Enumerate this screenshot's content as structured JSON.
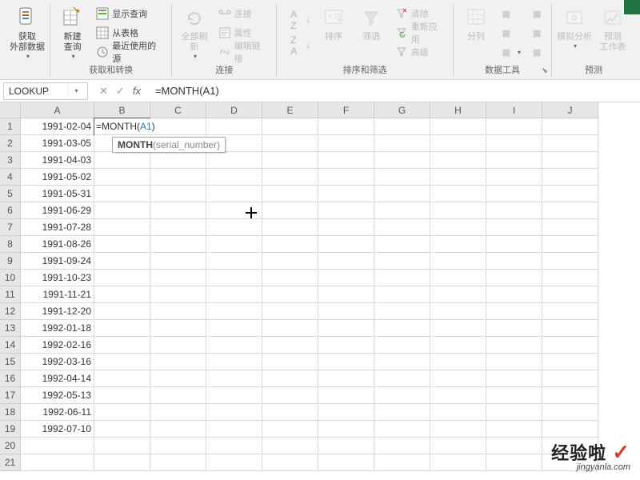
{
  "ribbon": {
    "g_data": {
      "get_data": "获取\n外部数据",
      "label": ""
    },
    "g_transform": {
      "new_query": "新建\n查询",
      "show_query": "显示查询",
      "from_table": "从表格",
      "recent_src": "最近使用的源",
      "label": "获取和转换"
    },
    "g_conn": {
      "refresh_all": "全部刷新",
      "connections": "连接",
      "properties": "属性",
      "edit_links": "编辑链接",
      "label": "连接"
    },
    "g_sort": {
      "sort_asc": "A↓Z",
      "sort_desc": "Z↓A",
      "sort": "排序",
      "filter": "筛选",
      "clear": "清除",
      "reapply": "重新应用",
      "advanced": "高级",
      "label": "排序和筛选"
    },
    "g_tools": {
      "text_cols": "分列",
      "label": "数据工具"
    },
    "g_forecast": {
      "whatif": "模拟分析",
      "fs_sheet": "预测\n工作表",
      "label": "预测"
    }
  },
  "fbar": {
    "namebox": "LOOKUP",
    "formula": "=MONTH(A1)"
  },
  "columns": [
    "A",
    "B",
    "C",
    "D",
    "E",
    "F",
    "G",
    "H",
    "I",
    "J"
  ],
  "rows": [
    "1",
    "2",
    "3",
    "4",
    "5",
    "6",
    "7",
    "8",
    "9",
    "10",
    "11",
    "12",
    "13",
    "14",
    "15",
    "16",
    "17",
    "18",
    "19",
    "20",
    "21"
  ],
  "col_a": [
    "1991-02-04",
    "1991-03-05",
    "1991-04-03",
    "1991-05-02",
    "1991-05-31",
    "1991-06-29",
    "1991-07-28",
    "1991-08-26",
    "1991-09-24",
    "1991-10-23",
    "1991-11-21",
    "1991-12-20",
    "1992-01-18",
    "1992-02-16",
    "1992-03-16",
    "1992-04-14",
    "1992-05-13",
    "1992-06-11",
    "1992-07-10"
  ],
  "edit_cell": {
    "prefix": "=MONTH(",
    "ref": "A1",
    "suffix": ")"
  },
  "tooltip": {
    "fn": "MONTH",
    "hint": "(serial_number)"
  },
  "watermark": {
    "main": "经验啦",
    "sub": "jingyanla.com"
  }
}
